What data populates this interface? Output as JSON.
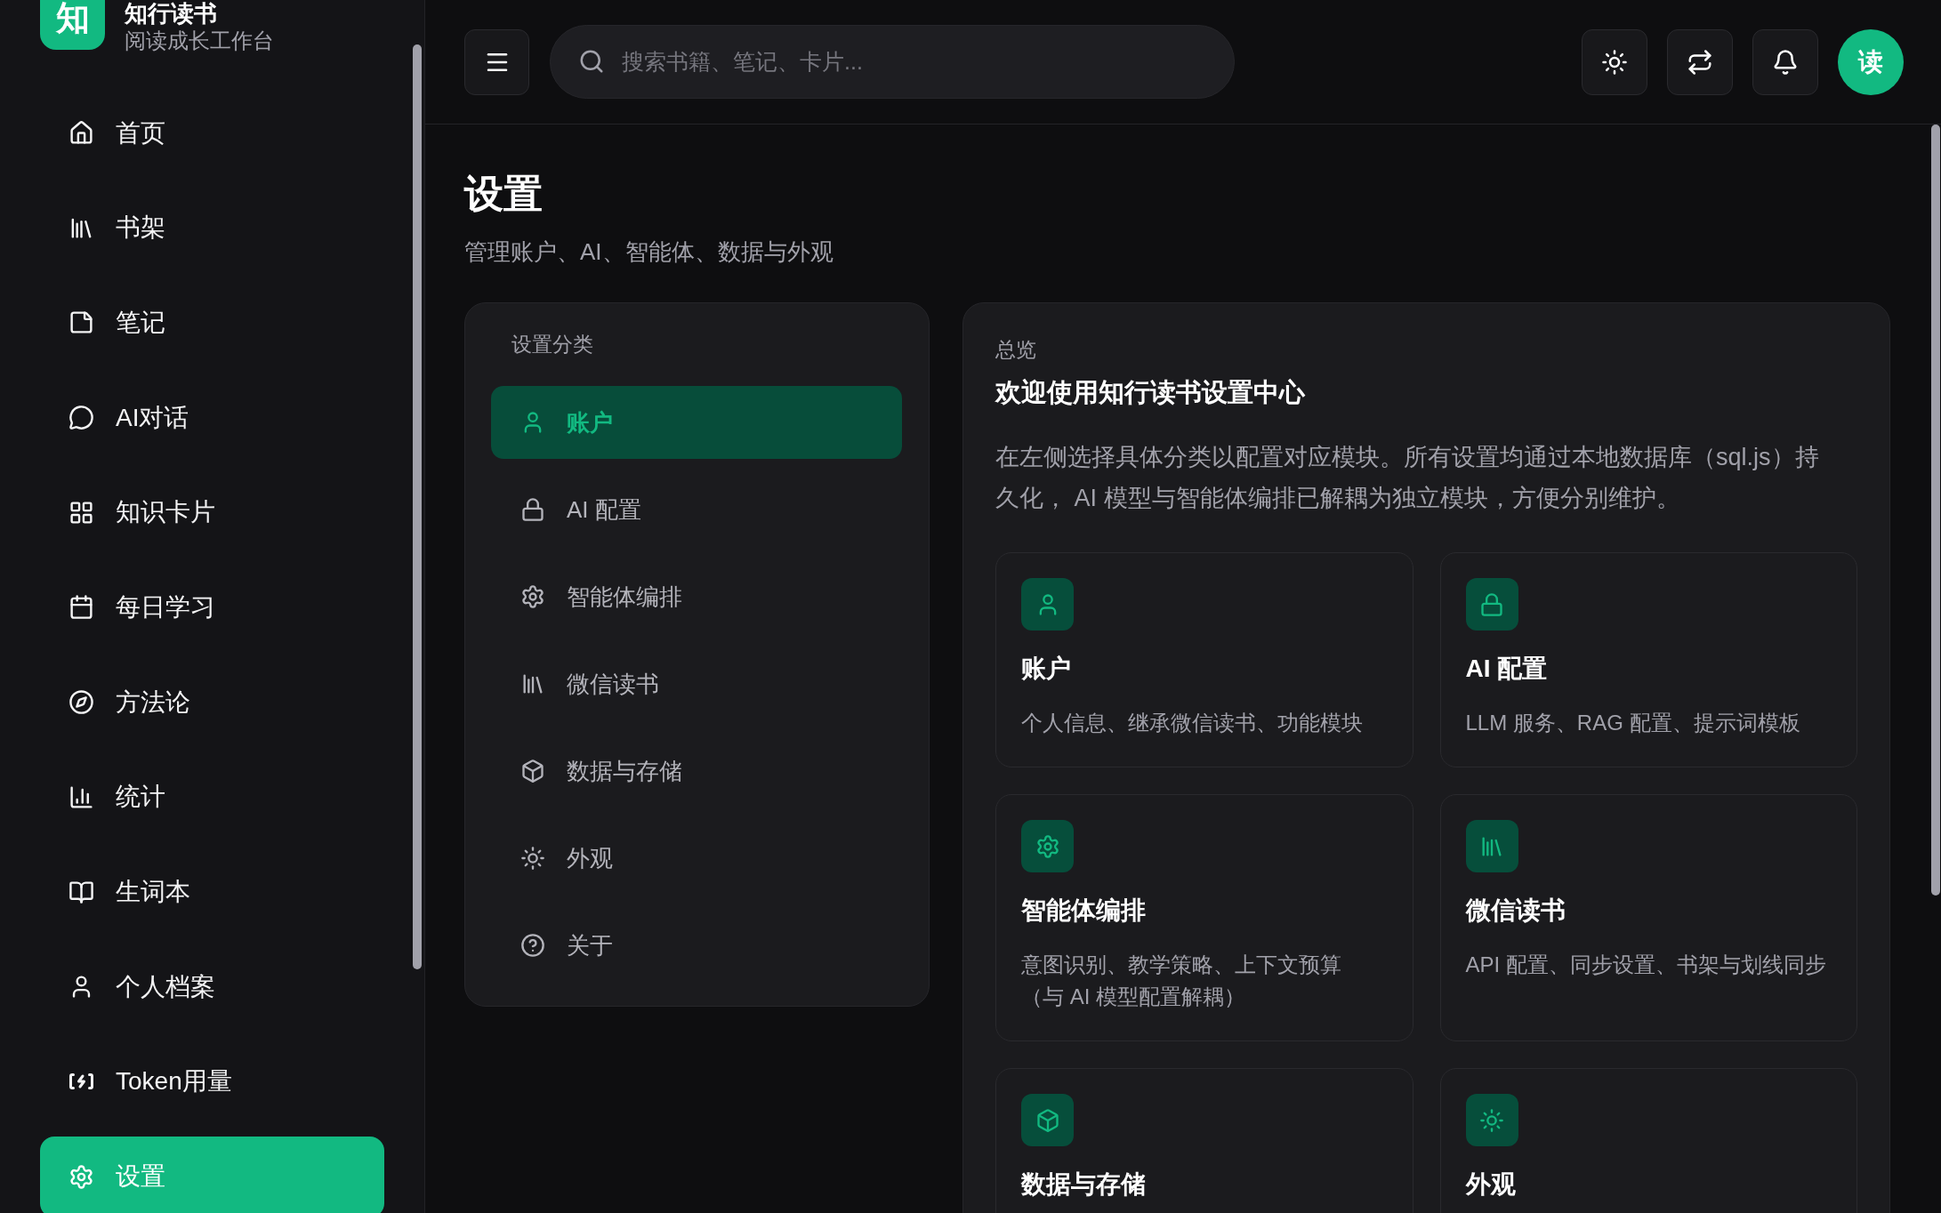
{
  "sidebar": {
    "logo": {
      "mark": "知",
      "title": "知行读书",
      "subtitle": "阅读成长工作台"
    },
    "items": [
      {
        "label": "首页",
        "selected": false
      },
      {
        "label": "书架",
        "selected": false
      },
      {
        "label": "笔记",
        "selected": false
      },
      {
        "label": "AI对话",
        "selected": false
      },
      {
        "label": "知识卡片",
        "selected": false
      },
      {
        "label": "每日学习",
        "selected": false
      },
      {
        "label": "方法论",
        "selected": false
      },
      {
        "label": "统计",
        "selected": false
      },
      {
        "label": "生词本",
        "selected": false
      },
      {
        "label": "个人档案",
        "selected": false
      },
      {
        "label": "Token用量",
        "selected": false
      },
      {
        "label": "设置",
        "selected": true
      }
    ]
  },
  "topbar": {
    "search": {
      "placeholder": "搜索书籍、笔记、卡片..."
    },
    "avatar": "读"
  },
  "page": {
    "title": "设置",
    "subtitle": "管理账户、AI、智能体、数据与外观"
  },
  "categories": {
    "title": "设置分类",
    "items": [
      {
        "label": "账户",
        "selected": true
      },
      {
        "label": "AI 配置",
        "selected": false
      },
      {
        "label": "智能体编排",
        "selected": false
      },
      {
        "label": "微信读书",
        "selected": false
      },
      {
        "label": "数据与存储",
        "selected": false
      },
      {
        "label": "外观",
        "selected": false
      },
      {
        "label": "关于",
        "selected": false
      }
    ]
  },
  "overview": {
    "eyebrow": "总览",
    "heading": "欢迎使用知行读书设置中心",
    "description": "在左侧选择具体分类以配置对应模块。所有设置均通过本地数据库（sql.js）持久化， AI 模型与智能体编排已解耦为独立模块，方便分别维护。",
    "cards": [
      {
        "title": "账户",
        "description": "个人信息、继承微信读书、功能模块"
      },
      {
        "title": "AI 配置",
        "description": "LLM 服务、RAG 配置、提示词模板"
      },
      {
        "title": "智能体编排",
        "description": "意图识别、教学策略、上下文预算（与 AI 模型配置解耦）"
      },
      {
        "title": "微信读书",
        "description": "API 配置、同步设置、书架与划线同步"
      },
      {
        "title": "数据与存储"
      },
      {
        "title": "外观"
      }
    ]
  }
}
